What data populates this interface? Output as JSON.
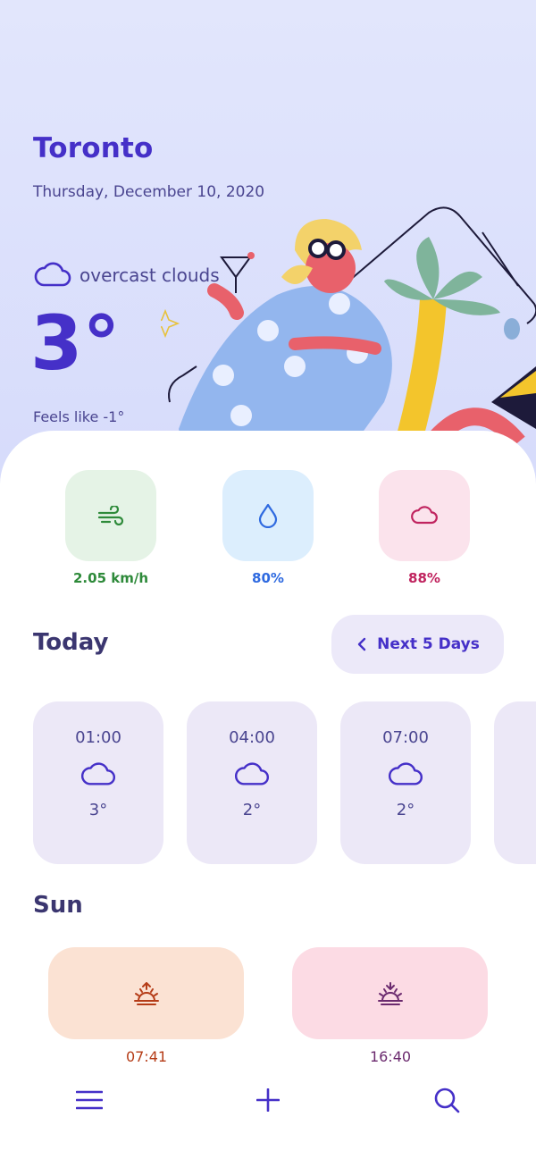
{
  "location": {
    "city": "Toronto",
    "date": "Thursday, December 10, 2020"
  },
  "current": {
    "condition": "overcast clouds",
    "condition_icon": "cloud-icon",
    "temperature": "3°",
    "feels_like": "Feels like -1°"
  },
  "metrics": [
    {
      "name": "wind",
      "icon": "wind-icon",
      "value": "2.05 km/h",
      "color": "#2e8a3a",
      "bg": "#e5f3e6"
    },
    {
      "name": "humidity",
      "icon": "droplet-icon",
      "value": "80%",
      "color": "#2f6ae0",
      "bg": "#dceefd"
    },
    {
      "name": "cloudiness",
      "icon": "cloud-icon",
      "value": "88%",
      "color": "#c0245f",
      "bg": "#fbe3ec"
    }
  ],
  "today": {
    "title": "Today",
    "next_button": "Next 5 Days",
    "hours": [
      {
        "time": "01:00",
        "icon": "cloud-icon",
        "temp": "3°"
      },
      {
        "time": "04:00",
        "icon": "cloud-icon",
        "temp": "2°"
      },
      {
        "time": "07:00",
        "icon": "cloud-icon",
        "temp": "2°"
      }
    ]
  },
  "sun": {
    "title": "Sun",
    "sunrise": {
      "icon": "sunrise-icon",
      "time": "07:41",
      "color": "#b53c17"
    },
    "sunset": {
      "icon": "sunset-icon",
      "time": "16:40",
      "color": "#6b2a6e"
    }
  },
  "nav": {
    "menu_icon": "menu-icon",
    "add_icon": "plus-icon",
    "search_icon": "search-icon"
  },
  "colors": {
    "accent": "#4530c8",
    "header_bg": "#dfe3fb",
    "text": "#3b3670"
  }
}
